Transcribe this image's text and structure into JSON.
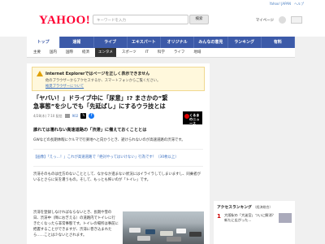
{
  "topstrip": {
    "links": [
      "Yahoo! JAPAN",
      "ヘルプ"
    ]
  },
  "header": {
    "logo": "YAHOO!",
    "logo_sub": "ニュース",
    "search_placeholder": "キーワードを入力",
    "search_button": "検索",
    "right_label": "マイページ"
  },
  "main_nav": {
    "items": [
      "トップ",
      "速報",
      "ライブ",
      "エキスパート",
      "オリジナル",
      "みんなの意見",
      "ランキング",
      "有料"
    ],
    "active_index": 0
  },
  "sub_nav": {
    "items": [
      "主要",
      "国内",
      "国際",
      "経済",
      "エンタメ",
      "スポーツ",
      "IT",
      "科学",
      "ライフ",
      "地域"
    ],
    "active_index": 4
  },
  "notice": {
    "title": "Internet Explorerではページを正しく表示できません",
    "line1": "他のブラウザーからアクセスするか、スマートフォンからご覧ください。",
    "link": "推奨ブラウザーについて"
  },
  "article": {
    "title": "「ヤバい！」ドライブ中に「尿意」!? まさかの“緊急事態”を少しでも「先延ばし」にするウラ技とは",
    "publisher_logo_text": "くるまのニュース",
    "date": "4/28(木) 7:10 配信",
    "comment_count": "902",
    "subhead": "誰れては濡れない高速道路の「渋滞」に備えておくこととは",
    "para1": "GWなどの長期休暇にクルマで行楽地へと向かうとき、避けられないのが高速道路の渋滞です。",
    "link_para": "【画像】「えっ…！」これが高速道路で「絶対やってはいけない」行為です！（30枚以上）",
    "para2": "渋滞そのものは仕方のないこととして、なかなか進まない状況にはイライラしてしまいますし、同乗者がいるとさらに気を遣うもの。そして、もっとも怖いのが「トイレ」です。",
    "para3": "渋滞を登録しなければならないとき、長期や雪の日、渋滞中（降におぎえる）の道路内でトイレに行きたくなったら非常事態です。トイレの場所は事前に把握することができますが、渋滞に巻き込まれたら……ことは少ないとされます。"
  },
  "ranking": {
    "title": "アクセスランキング",
    "subtitle": "（経済総合）",
    "items": [
      {
        "rank": "1",
        "text": "大阪駅の「大迷宮」ついに解消？ 新たに広がった..."
      }
    ]
  }
}
